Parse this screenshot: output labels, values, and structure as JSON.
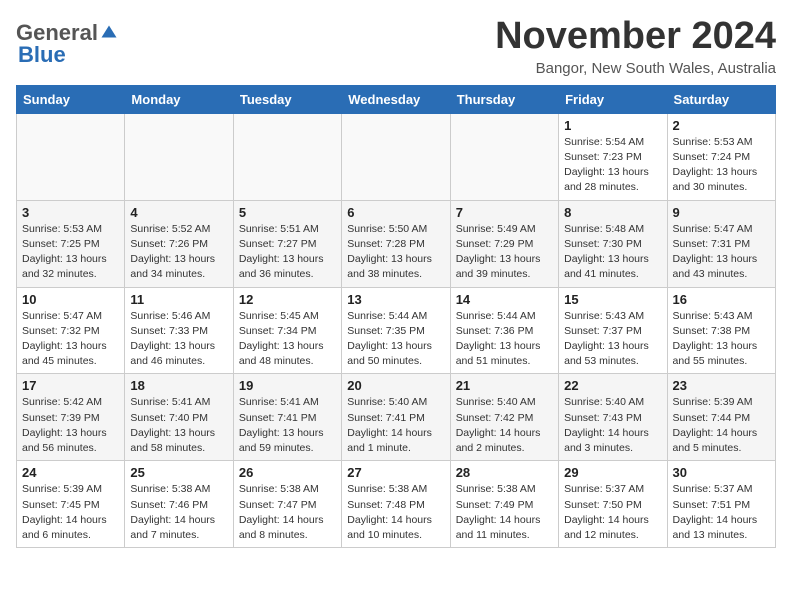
{
  "header": {
    "logo_general": "General",
    "logo_blue": "Blue",
    "month_title": "November 2024",
    "location": "Bangor, New South Wales, Australia"
  },
  "days_of_week": [
    "Sunday",
    "Monday",
    "Tuesday",
    "Wednesday",
    "Thursday",
    "Friday",
    "Saturday"
  ],
  "weeks": [
    [
      {
        "day": "",
        "info": ""
      },
      {
        "day": "",
        "info": ""
      },
      {
        "day": "",
        "info": ""
      },
      {
        "day": "",
        "info": ""
      },
      {
        "day": "",
        "info": ""
      },
      {
        "day": "1",
        "info": "Sunrise: 5:54 AM\nSunset: 7:23 PM\nDaylight: 13 hours\nand 28 minutes."
      },
      {
        "day": "2",
        "info": "Sunrise: 5:53 AM\nSunset: 7:24 PM\nDaylight: 13 hours\nand 30 minutes."
      }
    ],
    [
      {
        "day": "3",
        "info": "Sunrise: 5:53 AM\nSunset: 7:25 PM\nDaylight: 13 hours\nand 32 minutes."
      },
      {
        "day": "4",
        "info": "Sunrise: 5:52 AM\nSunset: 7:26 PM\nDaylight: 13 hours\nand 34 minutes."
      },
      {
        "day": "5",
        "info": "Sunrise: 5:51 AM\nSunset: 7:27 PM\nDaylight: 13 hours\nand 36 minutes."
      },
      {
        "day": "6",
        "info": "Sunrise: 5:50 AM\nSunset: 7:28 PM\nDaylight: 13 hours\nand 38 minutes."
      },
      {
        "day": "7",
        "info": "Sunrise: 5:49 AM\nSunset: 7:29 PM\nDaylight: 13 hours\nand 39 minutes."
      },
      {
        "day": "8",
        "info": "Sunrise: 5:48 AM\nSunset: 7:30 PM\nDaylight: 13 hours\nand 41 minutes."
      },
      {
        "day": "9",
        "info": "Sunrise: 5:47 AM\nSunset: 7:31 PM\nDaylight: 13 hours\nand 43 minutes."
      }
    ],
    [
      {
        "day": "10",
        "info": "Sunrise: 5:47 AM\nSunset: 7:32 PM\nDaylight: 13 hours\nand 45 minutes."
      },
      {
        "day": "11",
        "info": "Sunrise: 5:46 AM\nSunset: 7:33 PM\nDaylight: 13 hours\nand 46 minutes."
      },
      {
        "day": "12",
        "info": "Sunrise: 5:45 AM\nSunset: 7:34 PM\nDaylight: 13 hours\nand 48 minutes."
      },
      {
        "day": "13",
        "info": "Sunrise: 5:44 AM\nSunset: 7:35 PM\nDaylight: 13 hours\nand 50 minutes."
      },
      {
        "day": "14",
        "info": "Sunrise: 5:44 AM\nSunset: 7:36 PM\nDaylight: 13 hours\nand 51 minutes."
      },
      {
        "day": "15",
        "info": "Sunrise: 5:43 AM\nSunset: 7:37 PM\nDaylight: 13 hours\nand 53 minutes."
      },
      {
        "day": "16",
        "info": "Sunrise: 5:43 AM\nSunset: 7:38 PM\nDaylight: 13 hours\nand 55 minutes."
      }
    ],
    [
      {
        "day": "17",
        "info": "Sunrise: 5:42 AM\nSunset: 7:39 PM\nDaylight: 13 hours\nand 56 minutes."
      },
      {
        "day": "18",
        "info": "Sunrise: 5:41 AM\nSunset: 7:40 PM\nDaylight: 13 hours\nand 58 minutes."
      },
      {
        "day": "19",
        "info": "Sunrise: 5:41 AM\nSunset: 7:41 PM\nDaylight: 13 hours\nand 59 minutes."
      },
      {
        "day": "20",
        "info": "Sunrise: 5:40 AM\nSunset: 7:41 PM\nDaylight: 14 hours\nand 1 minute."
      },
      {
        "day": "21",
        "info": "Sunrise: 5:40 AM\nSunset: 7:42 PM\nDaylight: 14 hours\nand 2 minutes."
      },
      {
        "day": "22",
        "info": "Sunrise: 5:40 AM\nSunset: 7:43 PM\nDaylight: 14 hours\nand 3 minutes."
      },
      {
        "day": "23",
        "info": "Sunrise: 5:39 AM\nSunset: 7:44 PM\nDaylight: 14 hours\nand 5 minutes."
      }
    ],
    [
      {
        "day": "24",
        "info": "Sunrise: 5:39 AM\nSunset: 7:45 PM\nDaylight: 14 hours\nand 6 minutes."
      },
      {
        "day": "25",
        "info": "Sunrise: 5:38 AM\nSunset: 7:46 PM\nDaylight: 14 hours\nand 7 minutes."
      },
      {
        "day": "26",
        "info": "Sunrise: 5:38 AM\nSunset: 7:47 PM\nDaylight: 14 hours\nand 8 minutes."
      },
      {
        "day": "27",
        "info": "Sunrise: 5:38 AM\nSunset: 7:48 PM\nDaylight: 14 hours\nand 10 minutes."
      },
      {
        "day": "28",
        "info": "Sunrise: 5:38 AM\nSunset: 7:49 PM\nDaylight: 14 hours\nand 11 minutes."
      },
      {
        "day": "29",
        "info": "Sunrise: 5:37 AM\nSunset: 7:50 PM\nDaylight: 14 hours\nand 12 minutes."
      },
      {
        "day": "30",
        "info": "Sunrise: 5:37 AM\nSunset: 7:51 PM\nDaylight: 14 hours\nand 13 minutes."
      }
    ]
  ]
}
